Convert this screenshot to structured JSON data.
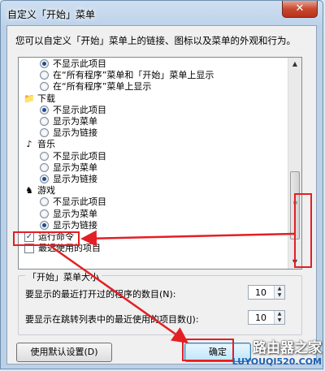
{
  "window": {
    "title": "自定义「开始」菜单",
    "close_label": "✕"
  },
  "description": "您可以自定义「开始」菜单上的链接、图标以及菜单的外观和行为。",
  "list": {
    "rows": [
      {
        "type": "radio",
        "label": "不显示此项目",
        "checked": true
      },
      {
        "type": "radio",
        "label": "在“所有程序”菜单和「开始」菜单上显示",
        "checked": false
      },
      {
        "type": "radio",
        "label": "在“所有程序”菜单上显示",
        "checked": false
      },
      {
        "type": "category",
        "label": "下载",
        "icon": "folder-download-icon"
      },
      {
        "type": "radio",
        "label": "不显示此项目",
        "checked": true
      },
      {
        "type": "radio",
        "label": "显示为菜单",
        "checked": false
      },
      {
        "type": "radio",
        "label": "显示为链接",
        "checked": false
      },
      {
        "type": "category",
        "label": "音乐",
        "icon": "music-note-icon"
      },
      {
        "type": "radio",
        "label": "不显示此项目",
        "checked": false
      },
      {
        "type": "radio",
        "label": "显示为菜单",
        "checked": false
      },
      {
        "type": "radio",
        "label": "显示为链接",
        "checked": true
      },
      {
        "type": "category",
        "label": "游戏",
        "icon": "games-icon"
      },
      {
        "type": "radio",
        "label": "不显示此项目",
        "checked": false
      },
      {
        "type": "radio",
        "label": "显示为菜单",
        "checked": false
      },
      {
        "type": "radio",
        "label": "显示为链接",
        "checked": true
      },
      {
        "type": "checkbox",
        "label": "运行命令",
        "checked": true
      },
      {
        "type": "checkbox",
        "label": "最近使用的项目",
        "checked": false
      }
    ]
  },
  "size_group": {
    "title": "「开始」菜单大小",
    "recent_programs_label": "要显示的最近打开过的程序的数目(N):",
    "recent_programs_value": "10",
    "jumplist_label": "要显示在跳转列表中的最近使用的项目数(J):",
    "jumplist_value": "10"
  },
  "buttons": {
    "defaults_label": "使用默认设置(D)",
    "ok_label": "确定"
  },
  "watermark": {
    "brand": "路由器之家",
    "url": "LUYOUQI520.COM"
  },
  "colors": {
    "annotation_red": "#e31f24",
    "title_bar": "#bcd1e6"
  }
}
